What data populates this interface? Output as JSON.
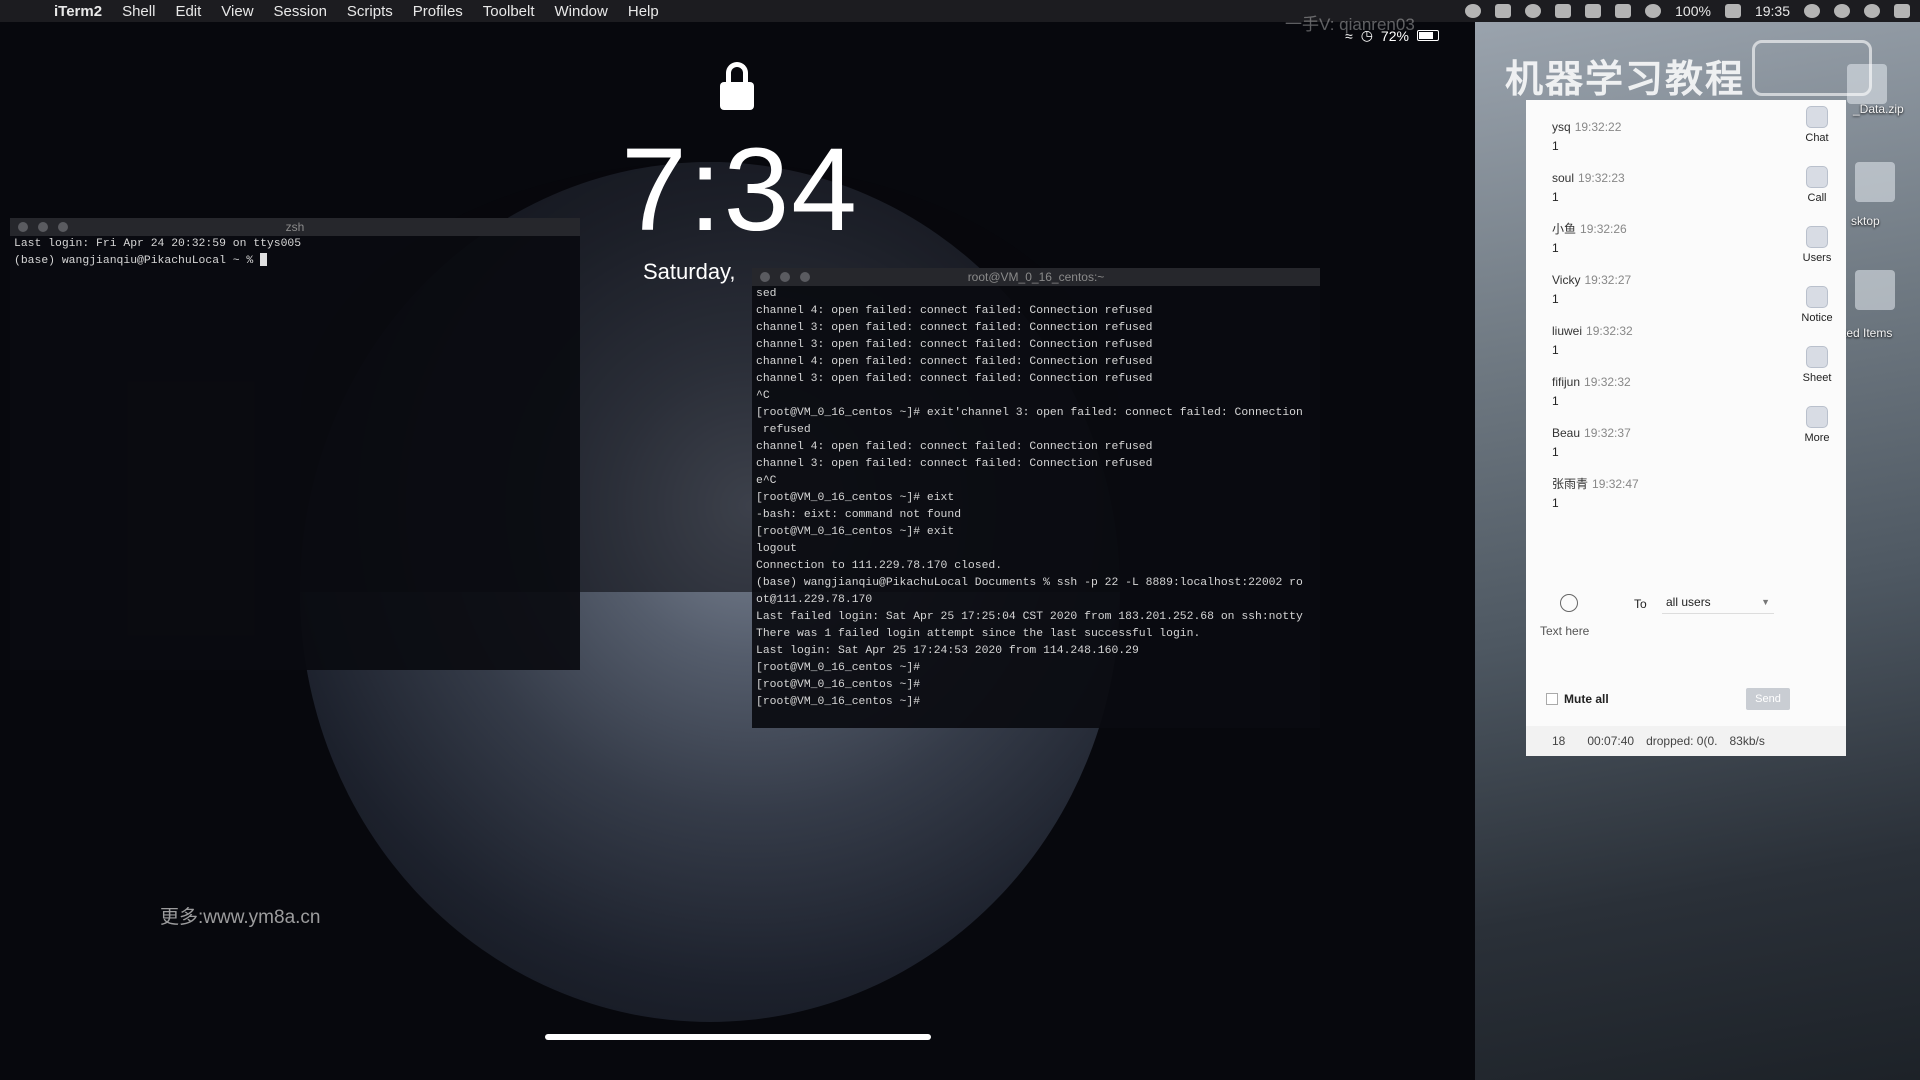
{
  "menubar": {
    "apple": "",
    "app": "iTerm2",
    "items": [
      "Shell",
      "Edit",
      "View",
      "Session",
      "Scripts",
      "Profiles",
      "Toolbelt",
      "Window",
      "Help"
    ],
    "battery": "100%",
    "clock": "19:35"
  },
  "overlay": {
    "top_watermark": "一手V: qianren03",
    "site_watermark": "更多:www.ym8a.cn",
    "banner": "机器学习教程"
  },
  "desktop": {
    "file_label": "_Data.zip",
    "folder_label": "sktop",
    "items_label": "ted Items"
  },
  "ipad": {
    "battery": "72%",
    "time": "7:34",
    "date": "Saturday,"
  },
  "term1": {
    "title": "zsh",
    "lines": [
      "Last login: Fri Apr 24 20:32:59 on ttys005",
      "(base) wangjianqiu@PikachuLocal ~ % "
    ]
  },
  "term2": {
    "title": "root@VM_0_16_centos:~",
    "lines": [
      "sed",
      "channel 4: open failed: connect failed: Connection refused",
      "channel 3: open failed: connect failed: Connection refused",
      "channel 3: open failed: connect failed: Connection refused",
      "channel 4: open failed: connect failed: Connection refused",
      "channel 3: open failed: connect failed: Connection refused",
      "^C",
      "[root@VM_0_16_centos ~]# exit'channel 3: open failed: connect failed: Connection",
      " refused",
      "channel 4: open failed: connect failed: Connection refused",
      "channel 3: open failed: connect failed: Connection refused",
      "e^C",
      "[root@VM_0_16_centos ~]# eixt",
      "-bash: eixt: command not found",
      "[root@VM_0_16_centos ~]# exit",
      "logout",
      "Connection to 111.229.78.170 closed.",
      "(base) wangjianqiu@PikachuLocal Documents % ssh -p 22 -L 8889:localhost:22002 ro",
      "ot@111.229.78.170",
      "Last failed login: Sat Apr 25 17:25:04 CST 2020 from 183.201.252.68 on ssh:notty",
      "There was 1 failed login attempt since the last successful login.",
      "Last login: Sat Apr 25 17:24:53 2020 from 114.248.160.29",
      "[root@VM_0_16_centos ~]#",
      "[root@VM_0_16_centos ~]#",
      "[root@VM_0_16_centos ~]#"
    ]
  },
  "chat": {
    "messages": [
      {
        "user": "ysq",
        "time": "19:32:22",
        "text": "1"
      },
      {
        "user": "soul",
        "time": "19:32:23",
        "text": "1"
      },
      {
        "user": "小鱼",
        "time": "19:32:26",
        "text": "1"
      },
      {
        "user": "Vicky",
        "time": "19:32:27",
        "text": "1"
      },
      {
        "user": "liuwei",
        "time": "19:32:32",
        "text": "1"
      },
      {
        "user": "fifijun",
        "time": "19:32:32",
        "text": "1"
      },
      {
        "user": "Beau",
        "time": "19:32:37",
        "text": "1"
      },
      {
        "user": "张雨青",
        "time": "19:32:47",
        "text": "1"
      }
    ],
    "side": [
      "Chat",
      "Call",
      "Users",
      "Notice",
      "Sheet",
      "More"
    ],
    "to_label": "To",
    "to_value": "all users",
    "placeholder": "Text here",
    "mute_label": "Mute all",
    "send_label": "Send",
    "stats": [
      "18",
      "00:07:40",
      "dropped: 0(0.",
      "83kb/s"
    ]
  }
}
